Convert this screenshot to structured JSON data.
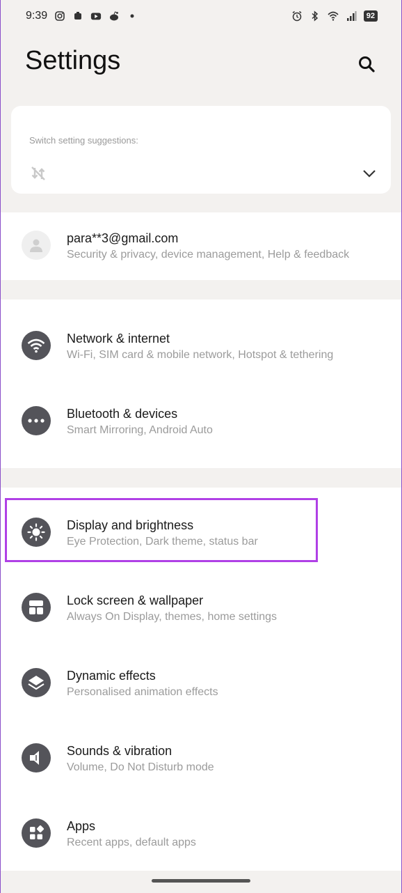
{
  "status_bar": {
    "time": "9:39",
    "battery": "92",
    "left_icons": [
      "instagram-icon",
      "notification-icon",
      "youtube-icon",
      "reddit-icon",
      "dot-icon"
    ],
    "right_icons": [
      "alarm-icon",
      "bluetooth-icon",
      "wifi-icon",
      "signal-icon"
    ]
  },
  "header": {
    "title": "Settings"
  },
  "suggestions": {
    "label": "Switch setting suggestions:"
  },
  "account": {
    "email": "para**3@gmail.com",
    "subtitle": "Security & privacy, device management, Help & feedback"
  },
  "items": [
    {
      "title": "Network & internet",
      "subtitle": "Wi-Fi, SIM card & mobile network, Hotspot & tethering",
      "icon": "wifi-icon"
    },
    {
      "title": "Bluetooth & devices",
      "subtitle": "Smart Mirroring, Android Auto",
      "icon": "more-dots-icon"
    },
    {
      "title": "Display and brightness",
      "subtitle": "Eye Protection, Dark theme, status bar",
      "icon": "sun-icon"
    },
    {
      "title": "Lock screen & wallpaper",
      "subtitle": "Always On Display, themes, home settings",
      "icon": "wallpaper-icon"
    },
    {
      "title": "Dynamic effects",
      "subtitle": "Personalised animation effects",
      "icon": "layers-icon"
    },
    {
      "title": "Sounds & vibration",
      "subtitle": "Volume, Do Not Disturb mode",
      "icon": "speaker-icon"
    },
    {
      "title": "Apps",
      "subtitle": "Recent apps, default apps",
      "icon": "apps-icon"
    }
  ],
  "colors": {
    "background": "#f3f1ef",
    "icon_circle": "#54545a",
    "highlight": "#b040e6"
  }
}
